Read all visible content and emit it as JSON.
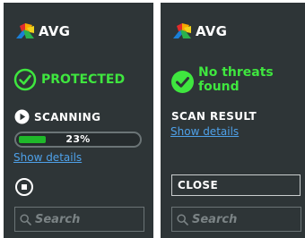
{
  "left_panel": {
    "logo_text": "AVG",
    "status_text": "PROTECTED",
    "scan_label": "SCANNING",
    "progress_percent": 23,
    "progress_text": "23%",
    "show_details_link": "Show details",
    "search_placeholder": "Search"
  },
  "right_panel": {
    "logo_text": "AVG",
    "status_text_line1": "No threats",
    "status_text_line2": "found",
    "result_label": "SCAN RESULT",
    "show_details_link": "Show details",
    "close_label": "CLOSE",
    "search_placeholder": "Search"
  },
  "icons": {
    "protected": "check-circle-outline-icon",
    "no_threats": "check-circle-filled-icon",
    "scanning": "play-circle-icon",
    "stop": "stop-circle-icon",
    "search": "magnifier-icon",
    "logo": "avg-logo-icon"
  },
  "colors": {
    "panel_bg": "#2e3537",
    "status_green": "#3fe63f",
    "link_blue": "#4ea1e9",
    "progress_fill": "#1fb82a"
  }
}
